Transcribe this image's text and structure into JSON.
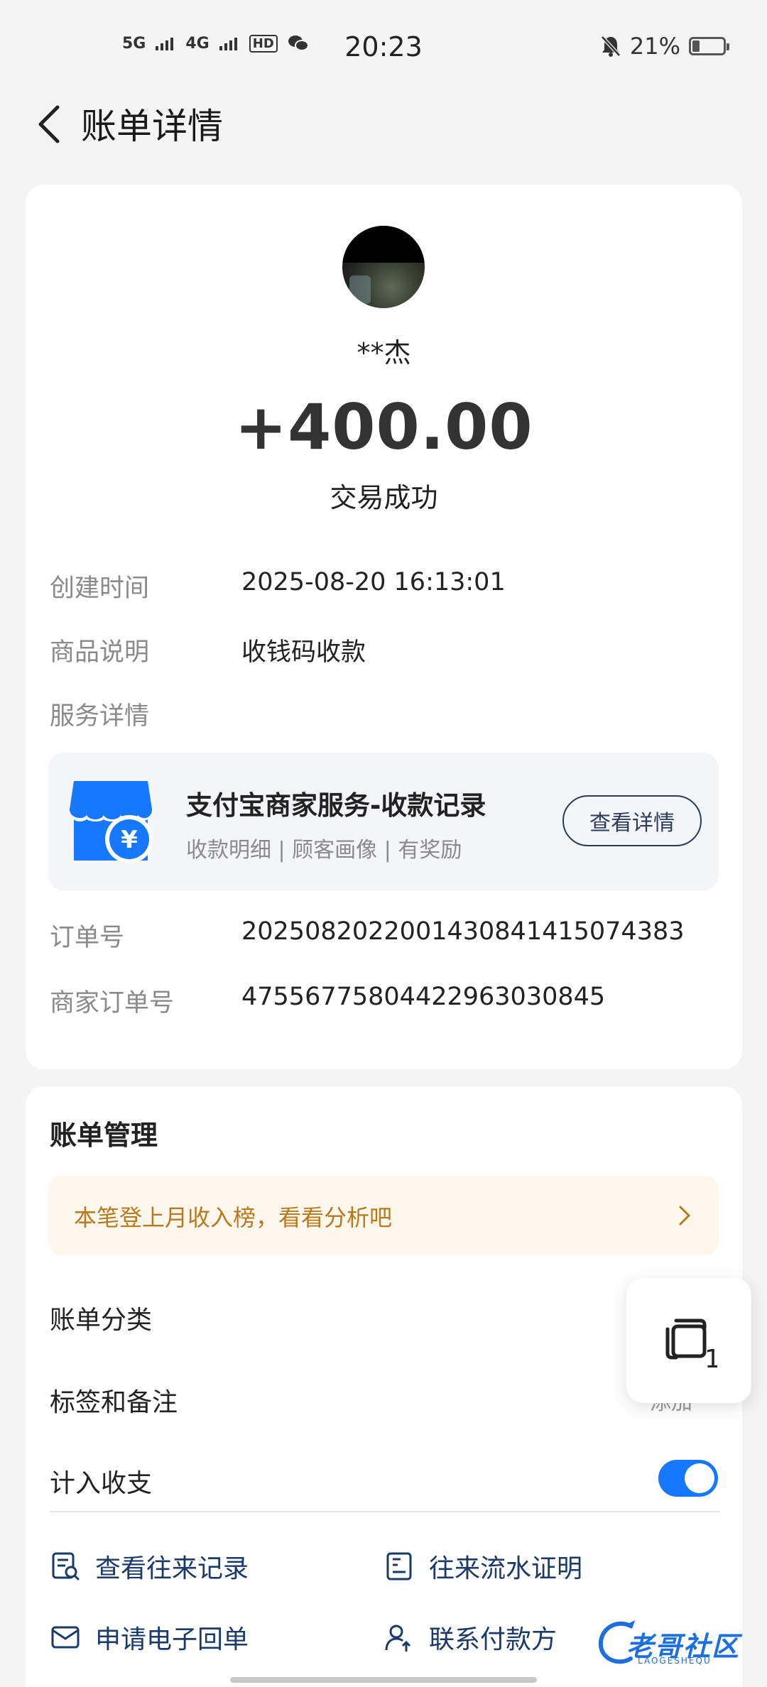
{
  "status_bar": {
    "signal_1": "5G",
    "signal_2": "4G",
    "hd_badge": "HD",
    "time": "20:23",
    "battery": "21%",
    "icons": [
      "5g-signal-icon",
      "4g-signal-icon",
      "hd-voice-icon",
      "wechat-icon",
      "mute-bell-icon",
      "battery-icon"
    ]
  },
  "header": {
    "title": "账单详情",
    "back_icon": "chevron-left-icon"
  },
  "transaction": {
    "payer": "**杰",
    "amount": "+400.00",
    "status": "交易成功"
  },
  "details": {
    "created_label": "创建时间",
    "created_value": "2025-08-20 16:13:01",
    "desc_label": "商品说明",
    "desc_value": "收钱码收款",
    "service_label": "服务详情",
    "order_label": "订单号",
    "order_value": "2025082022001430841415074383",
    "merchant_order_label": "商家订单号",
    "merchant_order_value": "47556775804422963030845"
  },
  "service": {
    "title": "支付宝商家服务-收款记录",
    "subtitle": "收款明细 | 顾客画像 | 有奖励",
    "button": "查看详情",
    "icon": "store-yuan-icon"
  },
  "manage": {
    "title": "账单管理",
    "tip": "本笔登上月收入榜，看看分析吧",
    "category_label": "账单分类",
    "tags_label": "标签和备注",
    "tags_hint": "添加",
    "include_label": "计入收支",
    "include_enabled": true
  },
  "actions": {
    "records": "查看往来记录",
    "statement": "往来流水证明",
    "receipt": "申请电子回单",
    "contact": "联系付款方"
  },
  "float_widget": {
    "count": "1"
  },
  "watermark": {
    "text": "老哥社区",
    "sub": "LAOGESHEQU"
  }
}
